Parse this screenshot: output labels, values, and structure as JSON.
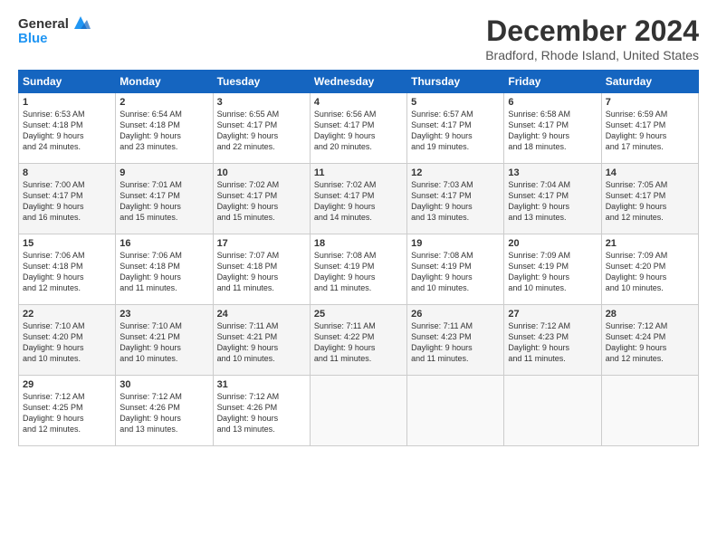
{
  "header": {
    "logo_line1": "General",
    "logo_line2": "Blue",
    "title": "December 2024",
    "subtitle": "Bradford, Rhode Island, United States"
  },
  "weekdays": [
    "Sunday",
    "Monday",
    "Tuesday",
    "Wednesday",
    "Thursday",
    "Friday",
    "Saturday"
  ],
  "weeks": [
    [
      {
        "day": "1",
        "info": "Sunrise: 6:53 AM\nSunset: 4:18 PM\nDaylight: 9 hours\nand 24 minutes."
      },
      {
        "day": "2",
        "info": "Sunrise: 6:54 AM\nSunset: 4:18 PM\nDaylight: 9 hours\nand 23 minutes."
      },
      {
        "day": "3",
        "info": "Sunrise: 6:55 AM\nSunset: 4:17 PM\nDaylight: 9 hours\nand 22 minutes."
      },
      {
        "day": "4",
        "info": "Sunrise: 6:56 AM\nSunset: 4:17 PM\nDaylight: 9 hours\nand 20 minutes."
      },
      {
        "day": "5",
        "info": "Sunrise: 6:57 AM\nSunset: 4:17 PM\nDaylight: 9 hours\nand 19 minutes."
      },
      {
        "day": "6",
        "info": "Sunrise: 6:58 AM\nSunset: 4:17 PM\nDaylight: 9 hours\nand 18 minutes."
      },
      {
        "day": "7",
        "info": "Sunrise: 6:59 AM\nSunset: 4:17 PM\nDaylight: 9 hours\nand 17 minutes."
      }
    ],
    [
      {
        "day": "8",
        "info": "Sunrise: 7:00 AM\nSunset: 4:17 PM\nDaylight: 9 hours\nand 16 minutes."
      },
      {
        "day": "9",
        "info": "Sunrise: 7:01 AM\nSunset: 4:17 PM\nDaylight: 9 hours\nand 15 minutes."
      },
      {
        "day": "10",
        "info": "Sunrise: 7:02 AM\nSunset: 4:17 PM\nDaylight: 9 hours\nand 15 minutes."
      },
      {
        "day": "11",
        "info": "Sunrise: 7:02 AM\nSunset: 4:17 PM\nDaylight: 9 hours\nand 14 minutes."
      },
      {
        "day": "12",
        "info": "Sunrise: 7:03 AM\nSunset: 4:17 PM\nDaylight: 9 hours\nand 13 minutes."
      },
      {
        "day": "13",
        "info": "Sunrise: 7:04 AM\nSunset: 4:17 PM\nDaylight: 9 hours\nand 13 minutes."
      },
      {
        "day": "14",
        "info": "Sunrise: 7:05 AM\nSunset: 4:17 PM\nDaylight: 9 hours\nand 12 minutes."
      }
    ],
    [
      {
        "day": "15",
        "info": "Sunrise: 7:06 AM\nSunset: 4:18 PM\nDaylight: 9 hours\nand 12 minutes."
      },
      {
        "day": "16",
        "info": "Sunrise: 7:06 AM\nSunset: 4:18 PM\nDaylight: 9 hours\nand 11 minutes."
      },
      {
        "day": "17",
        "info": "Sunrise: 7:07 AM\nSunset: 4:18 PM\nDaylight: 9 hours\nand 11 minutes."
      },
      {
        "day": "18",
        "info": "Sunrise: 7:08 AM\nSunset: 4:19 PM\nDaylight: 9 hours\nand 11 minutes."
      },
      {
        "day": "19",
        "info": "Sunrise: 7:08 AM\nSunset: 4:19 PM\nDaylight: 9 hours\nand 10 minutes."
      },
      {
        "day": "20",
        "info": "Sunrise: 7:09 AM\nSunset: 4:19 PM\nDaylight: 9 hours\nand 10 minutes."
      },
      {
        "day": "21",
        "info": "Sunrise: 7:09 AM\nSunset: 4:20 PM\nDaylight: 9 hours\nand 10 minutes."
      }
    ],
    [
      {
        "day": "22",
        "info": "Sunrise: 7:10 AM\nSunset: 4:20 PM\nDaylight: 9 hours\nand 10 minutes."
      },
      {
        "day": "23",
        "info": "Sunrise: 7:10 AM\nSunset: 4:21 PM\nDaylight: 9 hours\nand 10 minutes."
      },
      {
        "day": "24",
        "info": "Sunrise: 7:11 AM\nSunset: 4:21 PM\nDaylight: 9 hours\nand 10 minutes."
      },
      {
        "day": "25",
        "info": "Sunrise: 7:11 AM\nSunset: 4:22 PM\nDaylight: 9 hours\nand 11 minutes."
      },
      {
        "day": "26",
        "info": "Sunrise: 7:11 AM\nSunset: 4:23 PM\nDaylight: 9 hours\nand 11 minutes."
      },
      {
        "day": "27",
        "info": "Sunrise: 7:12 AM\nSunset: 4:23 PM\nDaylight: 9 hours\nand 11 minutes."
      },
      {
        "day": "28",
        "info": "Sunrise: 7:12 AM\nSunset: 4:24 PM\nDaylight: 9 hours\nand 12 minutes."
      }
    ],
    [
      {
        "day": "29",
        "info": "Sunrise: 7:12 AM\nSunset: 4:25 PM\nDaylight: 9 hours\nand 12 minutes."
      },
      {
        "day": "30",
        "info": "Sunrise: 7:12 AM\nSunset: 4:26 PM\nDaylight: 9 hours\nand 13 minutes."
      },
      {
        "day": "31",
        "info": "Sunrise: 7:12 AM\nSunset: 4:26 PM\nDaylight: 9 hours\nand 13 minutes."
      },
      null,
      null,
      null,
      null
    ]
  ]
}
